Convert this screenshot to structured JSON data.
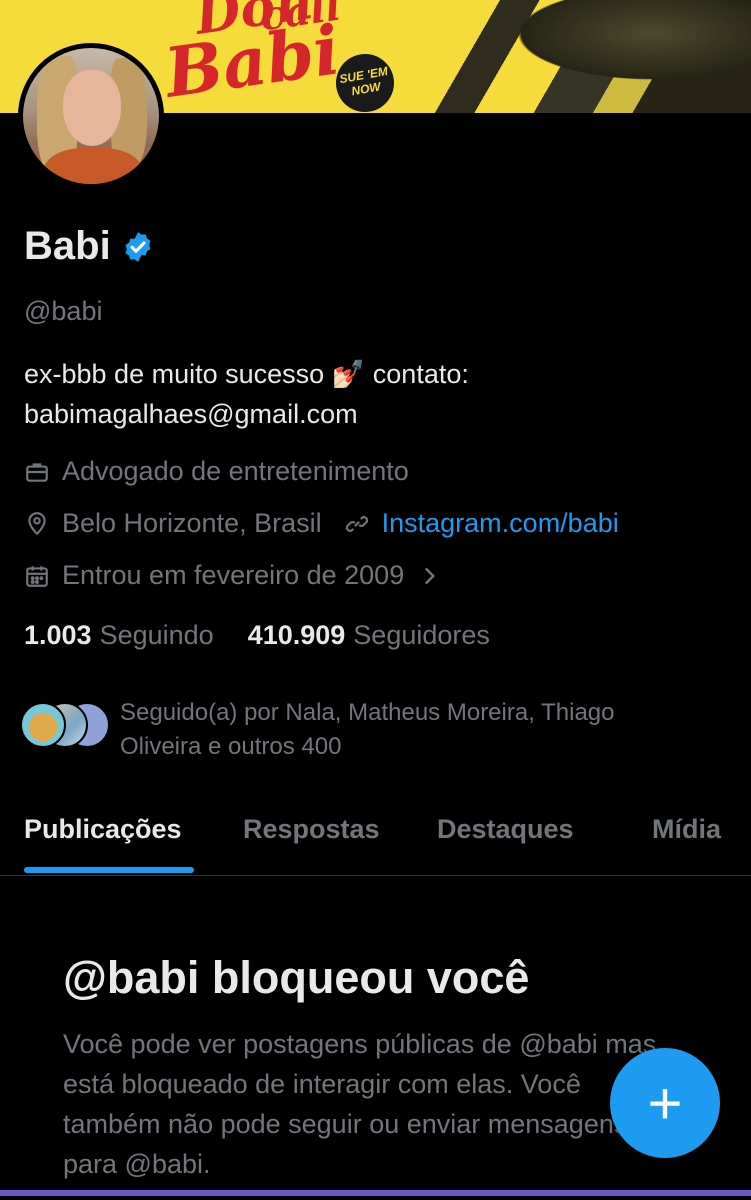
{
  "banner": {
    "title_line1": "Don",
    "title_line2": "call",
    "title_line3": "Babi",
    "badge": "SUE 'EM NOW"
  },
  "profile": {
    "name": "Babi",
    "handle": "@babi",
    "bio": "ex-bbb de muito sucesso 💅🏻 contato: babimagalhaes@gmail.com",
    "profession": "Advogado de entretenimento",
    "location": "Belo Horizonte, Brasil",
    "website": "Instagram.com/babi",
    "joined": "Entrou em fevereiro de 2009",
    "following_count": "1.003",
    "following_label": "Seguindo",
    "followers_count": "410.909",
    "followers_label": "Seguidores",
    "followed_by": "Seguido(a) por Nala, Matheus Moreira, Thiago Oliveira e outros 400"
  },
  "tabs": [
    {
      "label": "Publicações"
    },
    {
      "label": "Respostas"
    },
    {
      "label": "Destaques"
    },
    {
      "label": "Mídia"
    }
  ],
  "blocked": {
    "title": "@babi bloqueou você",
    "text": "Você pode ver postagens públicas de @babi mas está bloqueado de interagir com elas. Você também não pode seguir ou enviar mensagens para @babi."
  },
  "fab": {
    "label": "+"
  },
  "colors": {
    "accent": "#1d9bf0",
    "background": "#000000",
    "muted": "#71767b",
    "banner": "#f5dc3a"
  }
}
